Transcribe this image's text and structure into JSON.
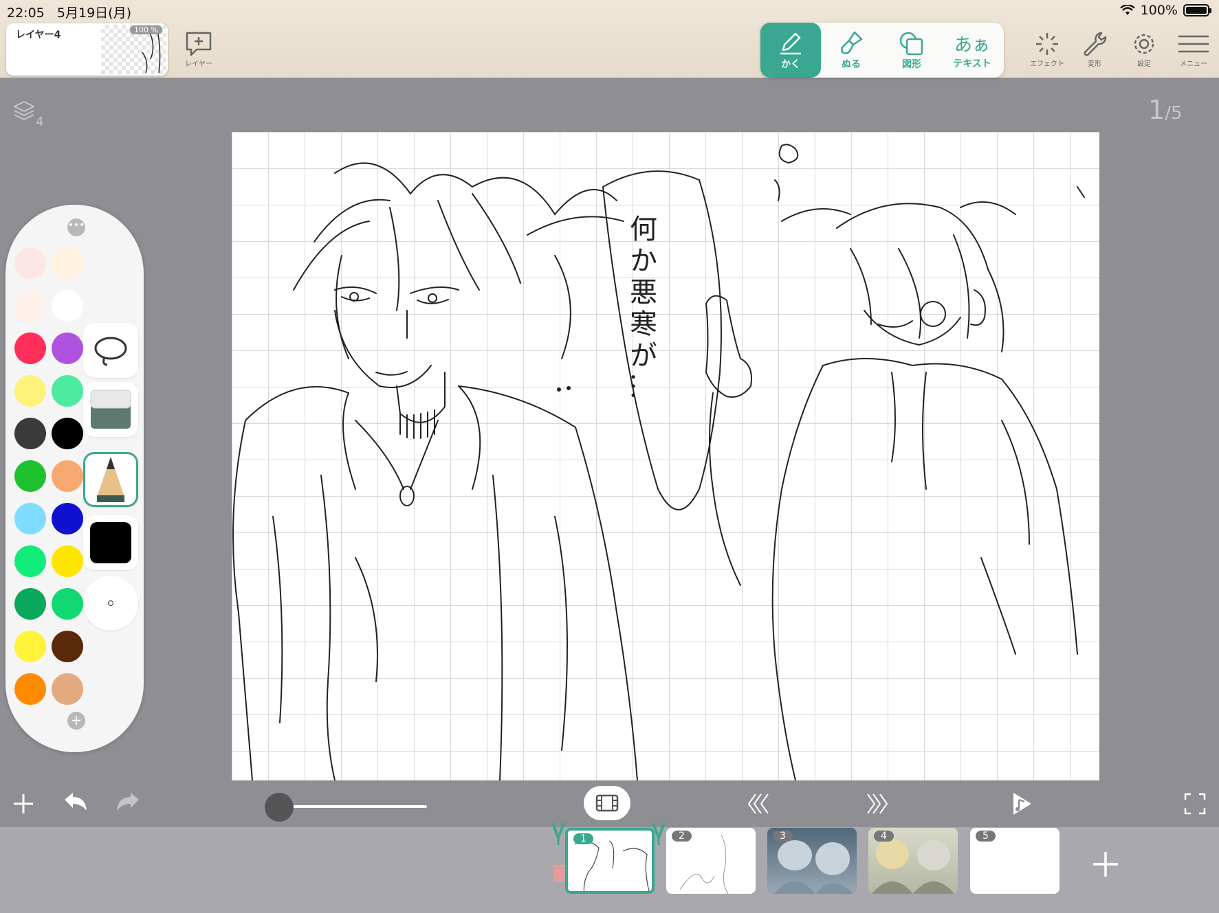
{
  "status": {
    "time": "22:05",
    "date": "5月19日(月)",
    "battery": "100%"
  },
  "layer": {
    "name": "レイヤー4",
    "opacity": "100 %",
    "add_label": "レイヤー"
  },
  "tools": {
    "draw": "かく",
    "fill": "ぬる",
    "shape": "図形",
    "text_icon": "あぁ",
    "text": "テキスト"
  },
  "right_tools": {
    "effect": "エフェクト",
    "transform": "変形",
    "settings": "設定",
    "menu": "メニュー"
  },
  "canvas": {
    "layer_count": "4",
    "page_current": "1",
    "page_total": "5",
    "speech_text": "何か悪寒が…"
  },
  "palette": {
    "colors": [
      "#ffe6e6",
      "#fff3e0",
      "#fff0ea",
      "#ffffff",
      "#ff2e5a",
      "#b052e0",
      "#fff27a",
      "#4deba0",
      "#3a3a3a",
      "#000000",
      "#1ec22e",
      "#f6a870",
      "#80dcff",
      "#1010d0",
      "#12ec7a",
      "#ffe600",
      "#0aa85a",
      "#12d872",
      "#fff23a",
      "#5a2a08",
      "#ff8c00",
      "#e4aa80"
    ],
    "current_color": "#000000"
  },
  "frames": [
    {
      "num": "1",
      "active": true
    },
    {
      "num": "2",
      "active": false
    },
    {
      "num": "3",
      "active": false
    },
    {
      "num": "4",
      "active": false
    },
    {
      "num": "5",
      "active": false
    }
  ]
}
